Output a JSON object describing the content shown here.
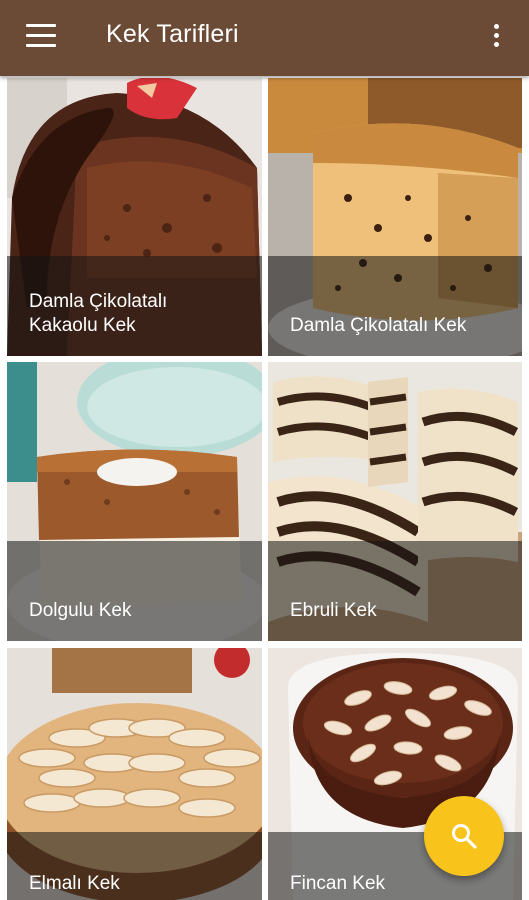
{
  "app": {
    "title": "Kek Tarifleri",
    "menu_icon": "hamburger-menu-icon",
    "overflow_icon": "more-vert-icon",
    "bar_color": "#6b4b36"
  },
  "recipes": [
    {
      "title": "Damla Çikolatalı Kakaolu Kek",
      "line1": "Damla Çikolatalı",
      "line2": "Kakaolu Kek"
    },
    {
      "title": "Damla Çikolatalı Kek"
    },
    {
      "title": "Dolgulu Kek"
    },
    {
      "title": "Ebruli Kek"
    },
    {
      "title": "Elmalı Kek"
    },
    {
      "title": "Fincan Kek"
    }
  ],
  "fab": {
    "icon": "search-icon",
    "color": "#f8c31a"
  }
}
